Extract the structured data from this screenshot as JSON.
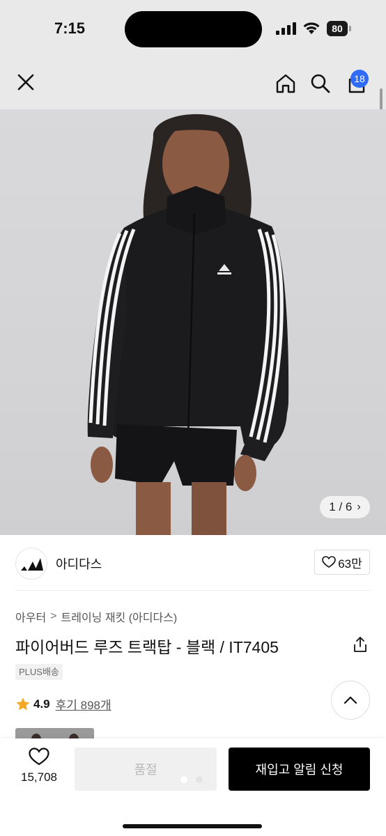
{
  "status_bar": {
    "time": "7:15",
    "battery": "80"
  },
  "nav": {
    "cart_count": "18",
    "icons": [
      "close-icon",
      "home-icon",
      "search-icon",
      "cart-icon"
    ]
  },
  "product_image": {
    "counter": "1 / 6",
    "logo_text": "adidas"
  },
  "brand": {
    "name": "아디다스",
    "likes": "63만"
  },
  "breadcrumb": {
    "category": "아우터",
    "separator": ">",
    "subcategory": "트레이닝 재킷 (아디다스)"
  },
  "product": {
    "title": "파이어버드 루즈 트랙탑 - 블랙 / IT7405",
    "shipping_badge": "PLUS배송",
    "rating": "4.9",
    "review_label": "후기 898개"
  },
  "bottom_bar": {
    "wish_count": "15,708",
    "soldout_label": "품절",
    "restock_label": "재입고 알림 신청"
  },
  "colors": {
    "accent_badge": "#2f6bf6",
    "star": "#f5a623",
    "primary_button": "#000000",
    "disabled_button": "#f0f0f0"
  }
}
